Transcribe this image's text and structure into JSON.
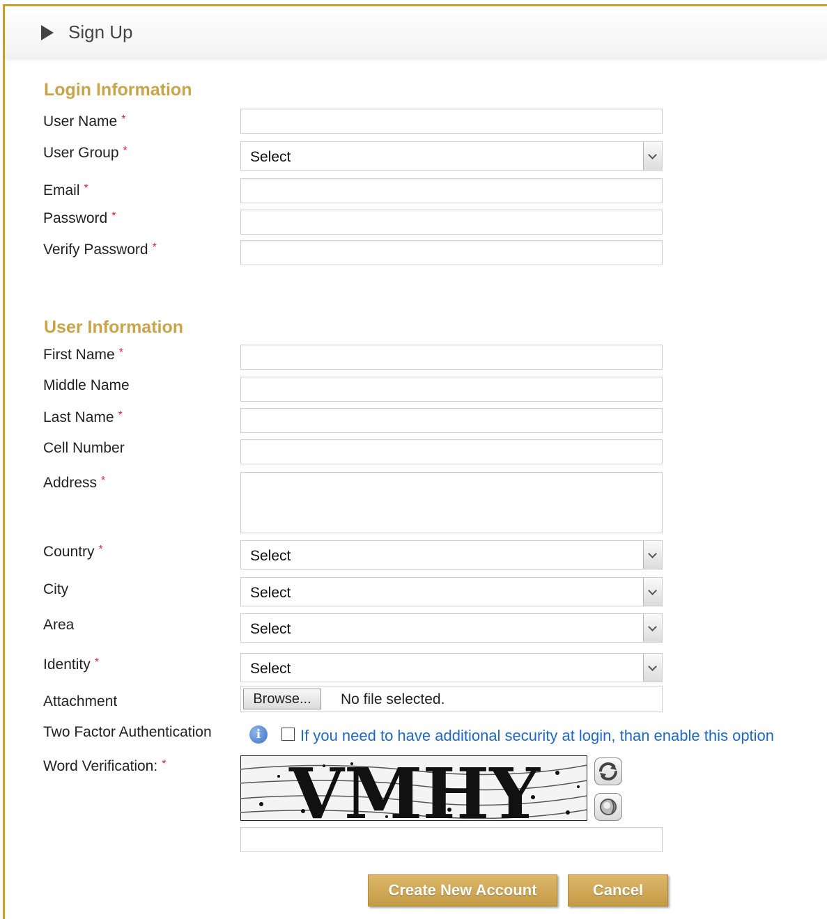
{
  "header": {
    "title": "Sign Up"
  },
  "sections": {
    "login": "Login Information",
    "user": "User Information"
  },
  "required_mark": "*",
  "labels": {
    "user_name": "User Name",
    "user_group": "User Group",
    "email": "Email",
    "password": "Password",
    "verify_password": "Verify Password",
    "first_name": "First Name",
    "middle_name": "Middle Name",
    "last_name": "Last Name",
    "cell_number": "Cell Number",
    "address": "Address",
    "country": "Country",
    "city": "City",
    "area": "Area",
    "identity": "Identity",
    "attachment": "Attachment",
    "two_factor": "Two Factor Authentication",
    "word_verification": "Word Verification:"
  },
  "selects": {
    "user_group": "Select",
    "country": "Select",
    "city": "Select",
    "area": "Select",
    "identity": "Select"
  },
  "attachment": {
    "browse_label": "Browse...",
    "status": "No file selected."
  },
  "two_factor": {
    "info_icon": "i",
    "text": "If you need to have additional security at login, than enable this option",
    "checked": false
  },
  "captcha": {
    "text": "VMHY",
    "icons": [
      "refresh-icon",
      "audio-icon"
    ]
  },
  "buttons": {
    "create": "Create New Account",
    "cancel": "Cancel"
  },
  "colors": {
    "accent": "#c9a227",
    "section_title": "#c9a44a",
    "link_blue": "#1f68c4",
    "required": "#dd2233"
  }
}
